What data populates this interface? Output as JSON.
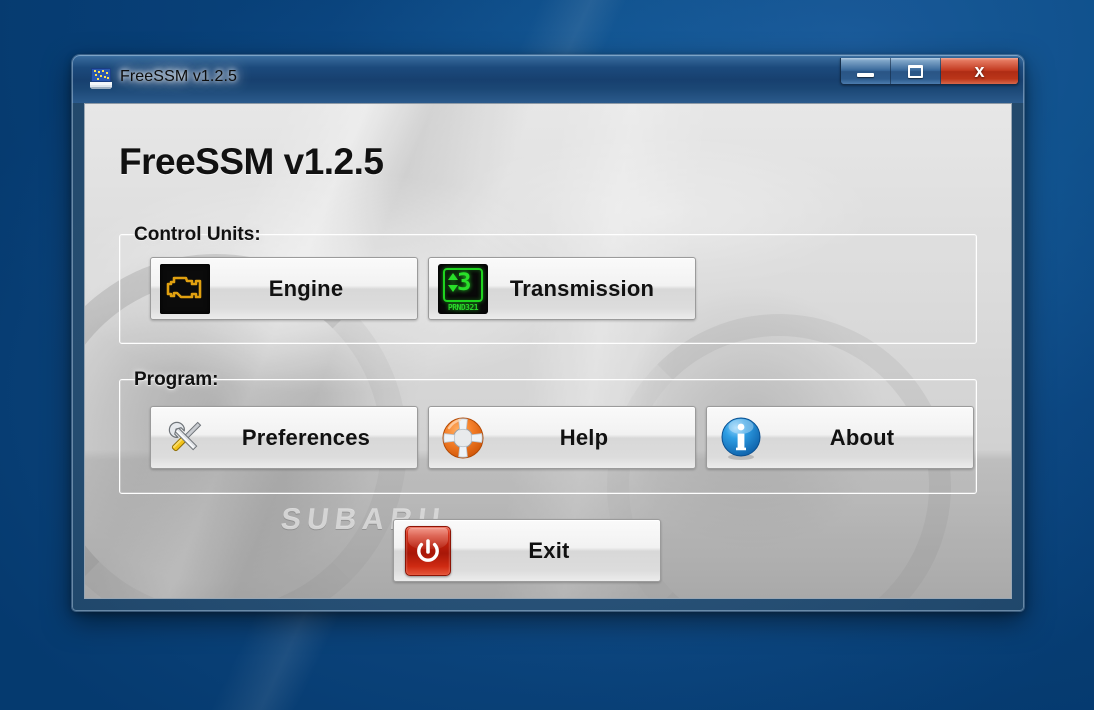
{
  "window": {
    "title": "FreeSSM v1.2.5",
    "app_icon": "screen-icon",
    "controls": {
      "minimize": "minimize-icon",
      "maximize": "maximize-icon",
      "close": "x",
      "close_label": "Close"
    }
  },
  "content": {
    "heading": "FreeSSM v1.2.5",
    "watermark_brand": "SUBARU",
    "groups": [
      {
        "label": "Control Units:",
        "buttons": [
          {
            "label": "Engine",
            "icon": "check-engine-light-icon"
          },
          {
            "label": "Transmission",
            "icon": "gear-indicator-icon"
          }
        ]
      },
      {
        "label": "Program:",
        "buttons": [
          {
            "label": "Preferences",
            "icon": "tools-icon"
          },
          {
            "label": "Help",
            "icon": "lifebuoy-icon"
          },
          {
            "label": "About",
            "icon": "info-icon"
          }
        ]
      }
    ],
    "exit_button": {
      "label": "Exit",
      "icon": "power-icon"
    }
  },
  "transmission_display": {
    "gear": "3",
    "range_legend": "PRND321"
  },
  "colors": {
    "desktop_blue": "#0b4f93",
    "titlebar_blue": "#17406f",
    "close_red": "#c23a20",
    "engine_amber": "#e09d10",
    "transmission_green": "#29e029",
    "help_orange": "#f07c22",
    "about_blue": "#1f8fdd",
    "exit_red": "#c8250e"
  }
}
